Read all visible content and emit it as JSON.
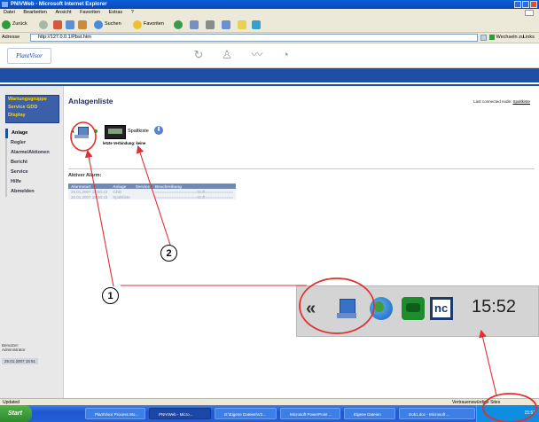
{
  "window": {
    "title": "PNIVWeb - Microsoft Internet Explorer"
  },
  "menu": [
    "Datei",
    "Bearbeiten",
    "Ansicht",
    "Favoriten",
    "Extras",
    "?"
  ],
  "toolbar": {
    "back": "Zurück",
    "search": "Suchen",
    "favorites": "Favoriten"
  },
  "address": {
    "label": "Adresse",
    "url": "http://127.0.0.1/Pbst.htm",
    "go": "Wechseln zu",
    "links": "Links"
  },
  "app": {
    "logo": "PlantVisor"
  },
  "sidebar": {
    "quick_links": [
      "Wartungsgruppe",
      "Service GDD",
      "Display"
    ],
    "nav": [
      "Anlage",
      "Regler",
      "Alarme/Aktionen",
      "Bericht",
      "Service",
      "Hilfe",
      "Abmelden"
    ],
    "user_label": "Benutzer:",
    "user": "Administrator",
    "date": "25.01.2007 15:51"
  },
  "content": {
    "title": "Anlagenliste",
    "last_connected_label": "Last connected node:",
    "last_connected_value": "Spaltkiste",
    "device_prefix": "A",
    "device_name": "Spaltkiste",
    "device_status": "letzte Verbindung: keine",
    "active_alarm_label": "Aktiver Alarm:",
    "alarm_table": {
      "headers": [
        "Alarmstart",
        "Anlage",
        "Service",
        "Beschreibung"
      ],
      "rows": [
        [
          "25.01.2007 15:50:43",
          "GDD",
          "",
          "==================Stoft============"
        ],
        [
          "25.01.2007 15:50:43",
          "Spaltkiste",
          "",
          "==================Stoft============"
        ]
      ]
    }
  },
  "statusbar": {
    "text": "Updated",
    "zone": "Vertrauenswürdige Sites"
  },
  "taskbar": {
    "start": "Start",
    "buttons": [
      "PlantVisor Process Mo...",
      "PNIVWeb - Micro...",
      "D:\\Eigene Dateien\\V2...",
      "Microsoft PowerPoint ...",
      "Eigene Dateien",
      "Dok1.doc - Microsoft ..."
    ],
    "clock": "15:52"
  },
  "callout": {
    "chevron": "«",
    "clock": "15:52",
    "icons": [
      "network-monitor-icon",
      "globe-icon",
      "phone-icon",
      "nc-icon"
    ],
    "marker_1": "1",
    "marker_2": "2"
  },
  "colors": {
    "highlight": "#e03030",
    "nav_blue": "#1f4fa3",
    "quick_links_bg": "#3b5fa8",
    "quick_links_text": "#ffd700"
  }
}
